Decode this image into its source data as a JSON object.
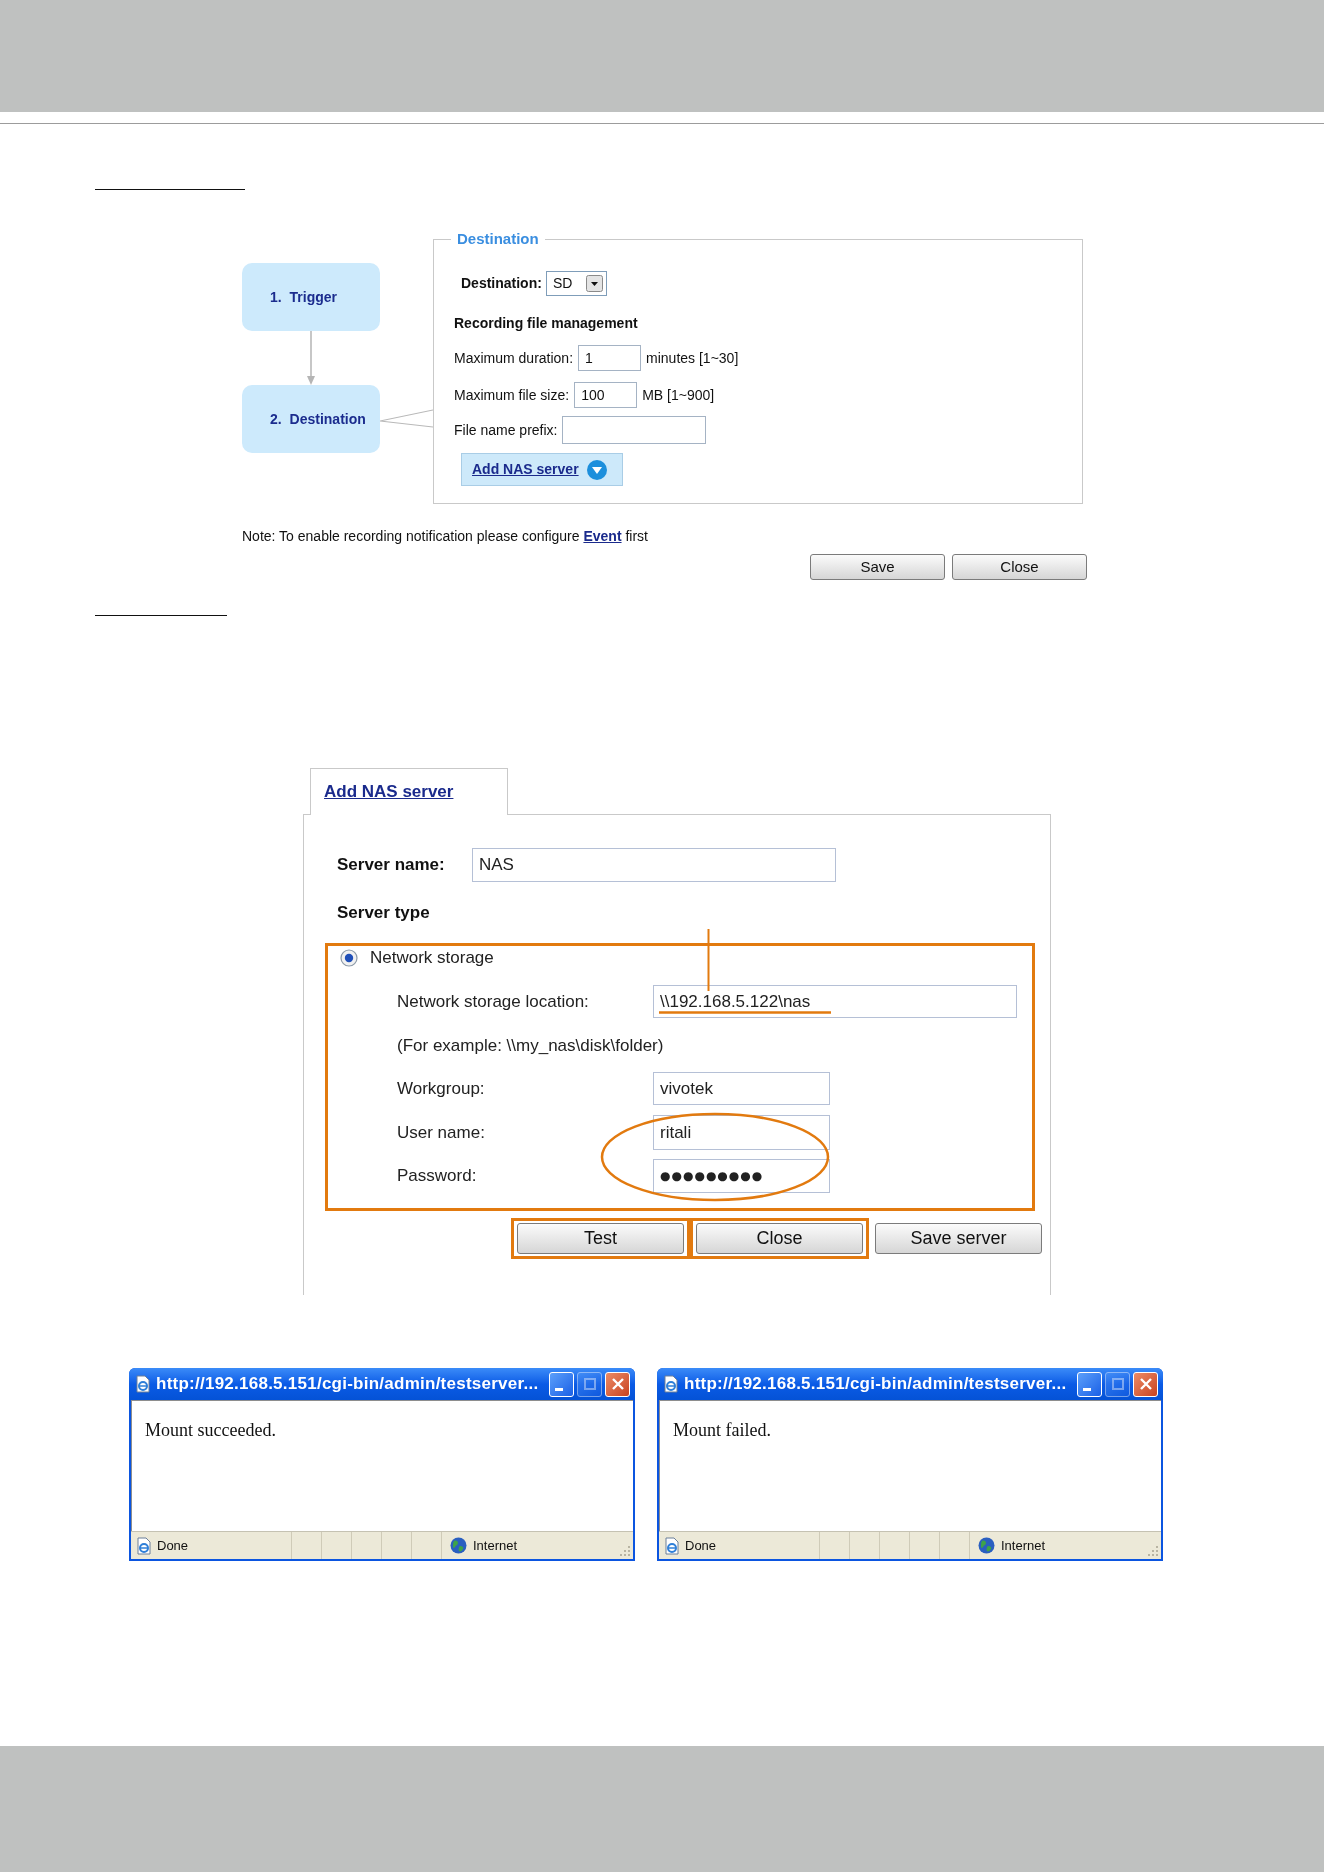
{
  "destination_section": {
    "steps": [
      {
        "label": "1. Trigger"
      },
      {
        "label": "2. Destination"
      }
    ],
    "panel": {
      "legend": "Destination",
      "destination": {
        "label": "Destination:",
        "value": "SD"
      },
      "title": "Recording file management",
      "fields": [
        {
          "label": "Maximum duration:",
          "value": "1",
          "unit": "minutes [1~30]"
        },
        {
          "label": "Maximum file size:",
          "value": "100",
          "unit": "MB [1~900]"
        },
        {
          "label": "File name prefix:"
        }
      ],
      "add_nas_button": "Add NAS server"
    },
    "note": {
      "text": "Note: To enable recording notification please configure",
      "link": "Event",
      "after": "first"
    },
    "buttons": [
      "Save",
      "Close"
    ]
  },
  "nas_section": {
    "tab": "Add NAS server",
    "server_name": {
      "label": "Server name:",
      "value": "NAS"
    },
    "server_type_title": "Server type",
    "storage_options": [
      {
        "label": "Network storage",
        "selected": true
      }
    ],
    "location": {
      "label": "Network storage location:",
      "value": "\\\\192.168.5.122\\nas"
    },
    "example": "(For example: \\\\my_nas\\disk\\folder)",
    "credentials": [
      {
        "label": "Workgroup:",
        "value": "vivotek"
      },
      {
        "label": "User name:",
        "value": "ritali"
      },
      {
        "label": "Password:",
        "value": "●●●●●●●●●"
      }
    ],
    "buttons": [
      {
        "label": "Test",
        "highlighted": true
      },
      {
        "label": "Close",
        "highlighted": true
      },
      {
        "label": "Save server",
        "highlighted": false
      }
    ]
  },
  "popups": [
    {
      "title": "http://192.168.5.151/cgi-bin/admin/testserver...",
      "window_buttons": [
        {
          "kind": "minimize",
          "disabled": false
        },
        {
          "kind": "maximize",
          "disabled": true
        },
        {
          "kind": "close",
          "disabled": false
        }
      ],
      "message": "Mount succeeded.",
      "status": "Done",
      "zone": "Internet"
    },
    {
      "title": "http://192.168.5.151/cgi-bin/admin/testserver...",
      "window_buttons": [
        {
          "kind": "minimize",
          "disabled": false
        },
        {
          "kind": "maximize",
          "disabled": true
        },
        {
          "kind": "close",
          "disabled": false
        }
      ],
      "message": "Mount failed.",
      "status": "Done",
      "zone": "Internet"
    }
  ]
}
